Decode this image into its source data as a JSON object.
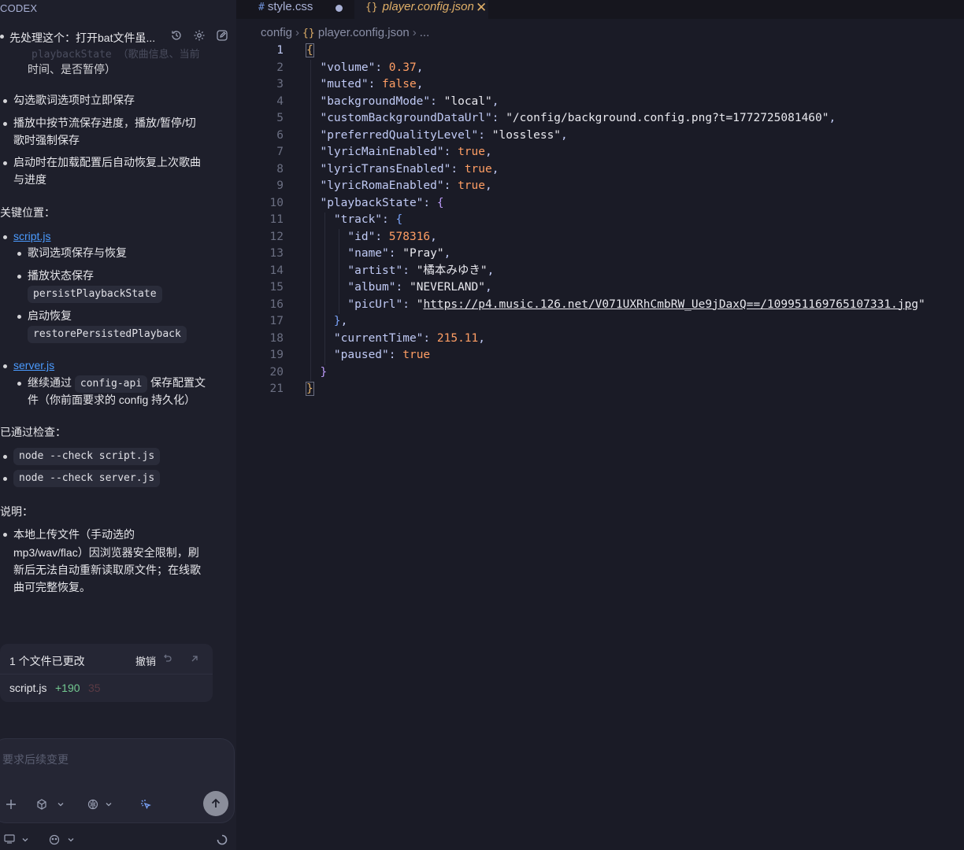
{
  "left_panel": {
    "app_title": "CODEX",
    "thread_title": "先处理这个：打开bat文件虽...",
    "faded_code": "playbackState",
    "faded_text": "（歌曲信息、当前",
    "continued": "时间、是否暂停）",
    "bullets": [
      "勾选歌词选项时立即保存",
      "播放中按节流保存进度，播放/暂停/切",
      "歌时强制保存",
      "启动时在加载配置后自动恢复上次歌曲",
      "与进度"
    ],
    "key_locations_heading": "关键位置：",
    "script_link": "script.js",
    "script_items": [
      "歌词选项保存与恢复",
      "播放状态保存",
      "启动恢复"
    ],
    "persist_code": "persistPlaybackState",
    "restore_code": "restorePersistedPlayback",
    "server_link": "server.js",
    "server_item_a": "继续通过",
    "server_code": "config-api",
    "server_item_b": "保存配置文",
    "server_item_c": "件（你前面要求的 config 持久化）",
    "checks_heading": "已通过检查：",
    "checks": [
      "node --check script.js",
      "node --check server.js"
    ],
    "notes_heading": "说明：",
    "notes": [
      "本地上传文件（手动选的",
      "mp3/wav/flac）因浏览器安全限制，刷",
      "新后无法自动重新读取原文件；在线歌",
      "曲可完整恢复。"
    ],
    "changes": {
      "title": "1 个文件已更改",
      "undo_label": "撤销",
      "file": "script.js",
      "additions": "+190",
      "deletions": "35"
    },
    "composer_placeholder": "要求后续变更"
  },
  "editor": {
    "tabs": [
      {
        "icon": "#",
        "label": "style.css",
        "modified": true
      },
      {
        "icon": "{}",
        "label": "player.config.json",
        "active": true
      }
    ],
    "breadcrumb": {
      "folder": "config",
      "icon": "{}",
      "file": "player.config.json",
      "more": "..."
    },
    "active_line": 1,
    "json": {
      "volume": "0.37",
      "muted": "false",
      "backgroundMode": "\"local\"",
      "customBackgroundDataUrl": "\"/config/background.config.png?t=1772725081460\"",
      "preferredQualityLevel": "\"lossless\"",
      "lyricMainEnabled": "true",
      "lyricTransEnabled": "true",
      "lyricRomaEnabled": "true",
      "track_id": "578316",
      "track_name": "\"Pray\"",
      "track_artist": "\"橘本みゆき\"",
      "track_album": "\"NEVERLAND\"",
      "track_picUrl": "https://p4.music.126.net/V071UXRhCmbRW_Ue9jDaxQ==/109951169765107331.jpg",
      "currentTime": "215.11",
      "paused": "true"
    }
  }
}
